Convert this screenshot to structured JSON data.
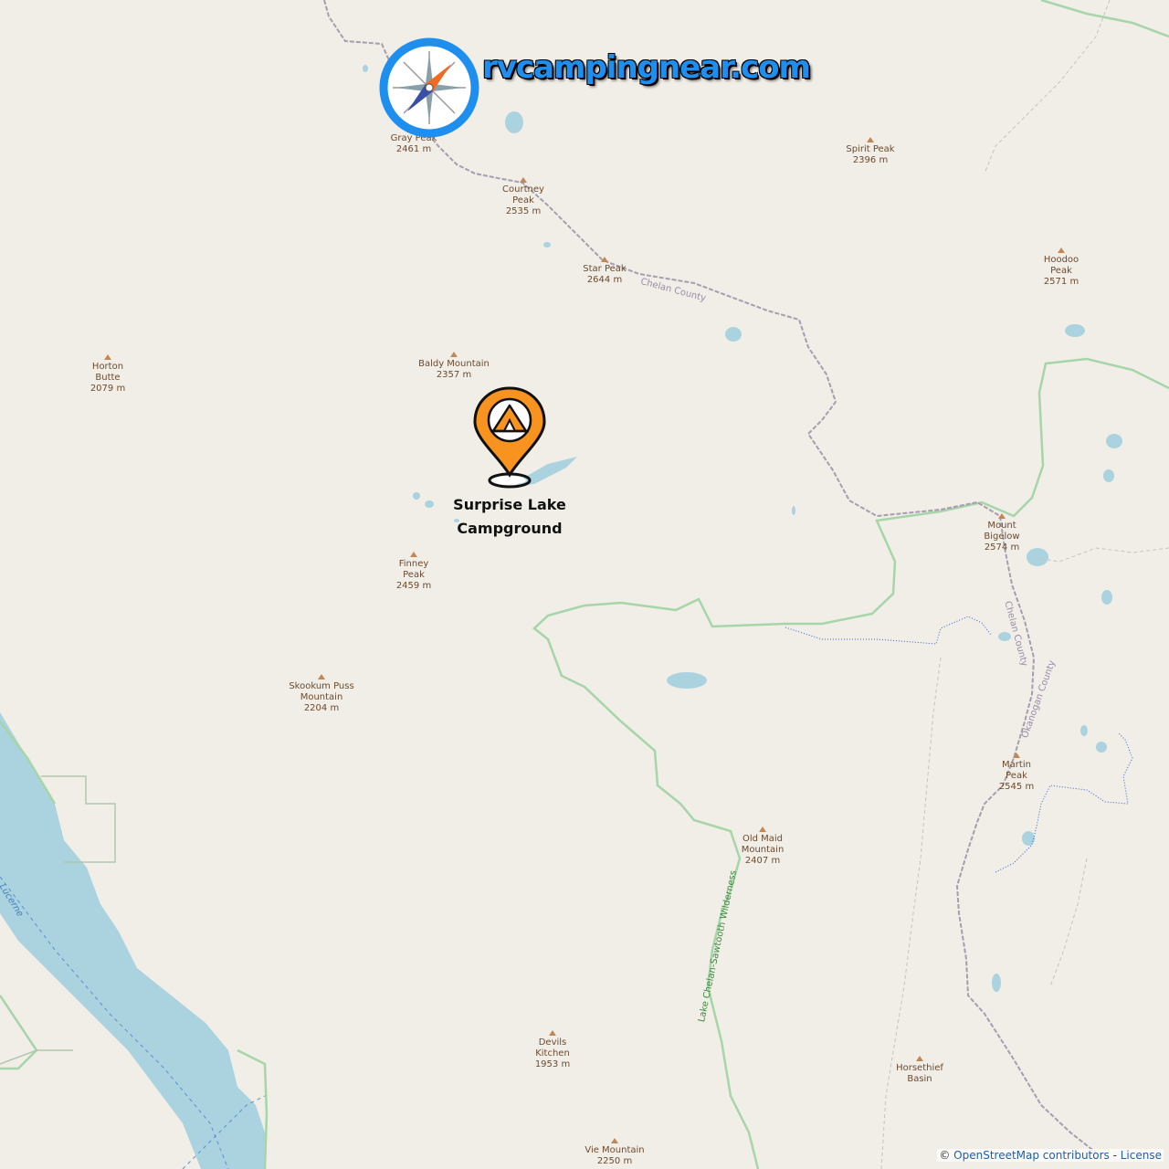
{
  "brand": {
    "text": "rvcampingnear.com",
    "logo_icon": "compass-icon"
  },
  "marker": {
    "icon": "campground-tent-icon",
    "label": "Surprise Lake Campground",
    "color": "#f7931e"
  },
  "peaks": [
    {
      "name": "Gray Peak",
      "elevation": "2461 m"
    },
    {
      "name": "Courtney Peak",
      "elevation": "2535 m"
    },
    {
      "name": "Spirit Peak",
      "elevation": "2396 m"
    },
    {
      "name": "Star Peak",
      "elevation": "2644 m"
    },
    {
      "name": "Hoodoo Peak",
      "elevation": "2571 m"
    },
    {
      "name": "Horton Butte",
      "elevation": "2079 m"
    },
    {
      "name": "Baldy Mountain",
      "elevation": "2357 m"
    },
    {
      "name": "Finney Peak",
      "elevation": "2459 m"
    },
    {
      "name": "Mount Bigelow",
      "elevation": "2574 m"
    },
    {
      "name": "Skookum Puss Mountain",
      "elevation": "2204 m"
    },
    {
      "name": "Martin Peak",
      "elevation": "2545 m"
    },
    {
      "name": "Old Maid Mountain",
      "elevation": "2407 m"
    },
    {
      "name": "Devils Kitchen",
      "elevation": "1953 m"
    },
    {
      "name": "Horsethief Basin",
      "elevation": ""
    },
    {
      "name": "Vie Mountain",
      "elevation": "2250 m"
    }
  ],
  "labels": {
    "county_chelan_1": "Chelan County",
    "county_chelan_2": "Chelan County",
    "county_okanogan": "Okanogan County",
    "wilderness": "Lake Chelan-Sawtooth Wilderness",
    "water": "Lucerne"
  },
  "attribution": {
    "prefix": "© ",
    "link": "OpenStreetMap contributors",
    "separator": " - ",
    "license": "License"
  },
  "colors": {
    "land": "#f1eee8",
    "water": "#aad3df",
    "boundary": "#8fcf9a",
    "county": "#a89cb0",
    "brand": "#1e8fee"
  }
}
